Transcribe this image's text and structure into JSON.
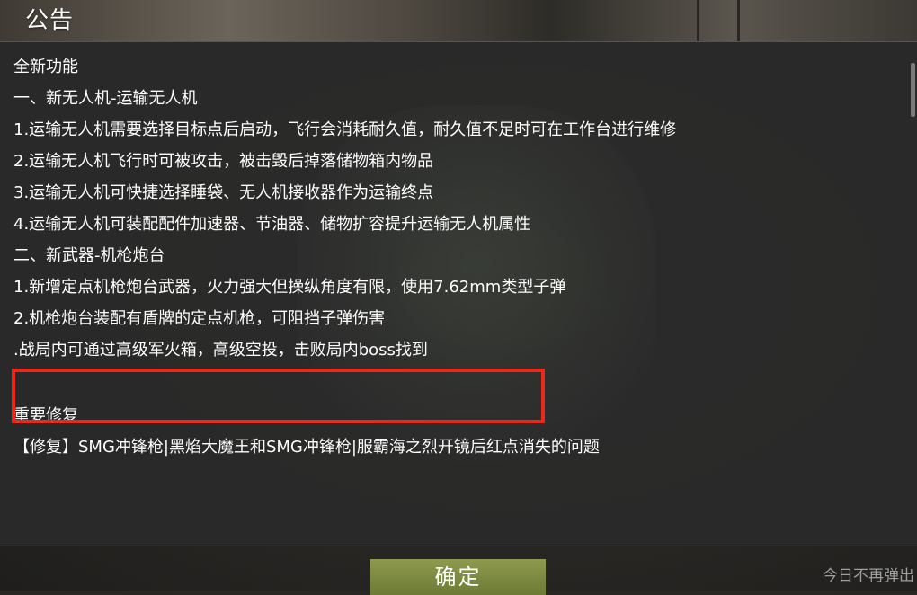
{
  "dialog": {
    "title": "公告"
  },
  "announcement": {
    "lines": [
      "全新功能",
      "一、新无人机-运输无人机",
      "1.运输无人机需要选择目标点后启动，飞行会消耗耐久值，耐久值不足时可在工作台进行维修",
      "2.运输无人机飞行时可被攻击，被击毁后掉落储物箱内物品",
      "3.运输无人机可快捷选择睡袋、无人机接收器作为运输终点",
      "4.运输无人机可装配配件加速器、节油器、储物扩容提升运输无人机属性",
      "二、新武器-机枪炮台",
      "1.新增定点机枪炮台武器，火力强大但操纵角度有限，使用7.62mm类型子弹",
      "2.机枪炮台装配有盾牌的定点机枪，可阻挡子弹伤害",
      ".战局内可通过高级军火箱，高级空投，击败局内boss找到",
      "重要修复",
      "【修复】SMG冲锋枪|黑焰大魔王和SMG冲锋枪|服霸海之烈开镜后红点消失的问题"
    ]
  },
  "footer": {
    "confirm_label": "确定",
    "dont_show_today_label": "今日不再弹出"
  },
  "colors": {
    "highlight_border": "#e8291b",
    "confirm_button": "#7c8a40"
  }
}
